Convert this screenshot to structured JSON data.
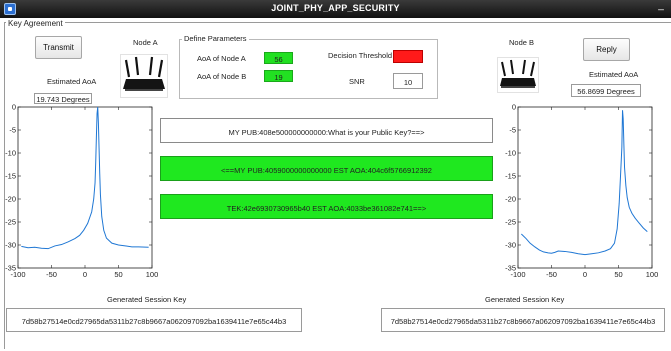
{
  "window": {
    "title": "JOINT_PHY_APP_SECURITY",
    "minimize_glyph": "_"
  },
  "panel": {
    "title": "Key Agreement"
  },
  "node_a": {
    "label": "Node A",
    "button_label": "Transmit",
    "estimated_label": "Estimated AoA",
    "estimated_value": "19.743 Degrees",
    "session_label": "Generated Session Key",
    "session_key": "7d58b27514e0cd27965da5311b27c8b9667a062097092ba1639411e7e65c44b3",
    "icon": "router-icon"
  },
  "node_b": {
    "label": "Node B",
    "button_label": "Reply",
    "estimated_label": "Estimated AoA",
    "estimated_value": "56.8699 Degrees",
    "session_label": "Generated Session Key",
    "session_key": "7d58b27514e0cd27965da5311b27c8b9667a062097092ba1639411e7e65c44b3",
    "icon": "router-icon"
  },
  "params": {
    "title": "Define Parameters",
    "aoa_a_label": "AoA of Node A",
    "aoa_a_value": "56",
    "aoa_b_label": "AoA of Node B",
    "aoa_b_value": "19",
    "threshold_label": "Decision Threshold",
    "threshold_value": "",
    "snr_label": "SNR",
    "snr_value": "10"
  },
  "messages": [
    {
      "text": "MY PUB:408e500000000000:What is your Public Key?==>",
      "style": "white"
    },
    {
      "text": "<==MY PUB:4059000000000000 EST AOA:404c6f5766912392",
      "style": "green"
    },
    {
      "text": "TEK:42e6930730965b40 EST AOA:4033be361082e741==>",
      "style": "green"
    }
  ],
  "colors": {
    "accent_green": "#22e022",
    "alert_red": "#ff1a1a",
    "plot_line": "#1f77d4"
  },
  "chart_data": [
    {
      "type": "line",
      "title": "",
      "xlabel": "",
      "ylabel": "",
      "xlim": [
        -100,
        100
      ],
      "ylim": [
        -35,
        0
      ],
      "xticks": [
        -100,
        -50,
        0,
        50,
        100
      ],
      "yticks": [
        0,
        -5,
        -10,
        -15,
        -20,
        -25,
        -30,
        -35
      ],
      "x": [
        -95,
        -85,
        -75,
        -65,
        -55,
        -45,
        -35,
        -25,
        -15,
        -8,
        -2,
        4,
        10,
        13,
        15,
        16,
        17,
        18,
        19,
        20,
        21,
        22,
        23,
        25,
        28,
        32,
        40,
        50,
        60,
        70,
        80,
        95
      ],
      "y": [
        -30.3,
        -30.6,
        -30.5,
        -30.7,
        -30.8,
        -30.2,
        -29.9,
        -29.3,
        -28.6,
        -27.9,
        -26.8,
        -25.3,
        -22.8,
        -20,
        -16.5,
        -12,
        -6.5,
        -1.4,
        0,
        -3.5,
        -9,
        -14.5,
        -19,
        -23.8,
        -26.8,
        -28.5,
        -29.6,
        -30,
        -30.2,
        -30.4,
        -30.4,
        -30.5
      ]
    },
    {
      "type": "line",
      "title": "",
      "xlabel": "",
      "ylabel": "",
      "xlim": [
        -100,
        100
      ],
      "ylim": [
        -35,
        0
      ],
      "xticks": [
        -100,
        -50,
        0,
        50,
        100
      ],
      "yticks": [
        0,
        -5,
        -10,
        -15,
        -20,
        -25,
        -30,
        -35
      ],
      "x": [
        -95,
        -88,
        -82,
        -75,
        -68,
        -62,
        -55,
        -50,
        -45,
        -40,
        -30,
        -20,
        -10,
        0,
        10,
        20,
        30,
        38,
        44,
        48,
        51,
        53,
        55,
        56,
        57,
        58,
        59,
        61,
        63,
        66,
        70,
        75,
        80,
        87,
        93
      ],
      "y": [
        -27.6,
        -28.6,
        -29.6,
        -30.4,
        -31.1,
        -31.5,
        -31.7,
        -31.8,
        -31.6,
        -31.3,
        -31.4,
        -31.6,
        -31.9,
        -32.1,
        -31.9,
        -31.7,
        -31.3,
        -30.8,
        -29.6,
        -26.5,
        -21,
        -15,
        -8.8,
        -0.7,
        -2.6,
        -8,
        -13.1,
        -17.1,
        -19.7,
        -21.8,
        -23.1,
        -24.2,
        -25.1,
        -26.3,
        -27.1
      ]
    }
  ]
}
